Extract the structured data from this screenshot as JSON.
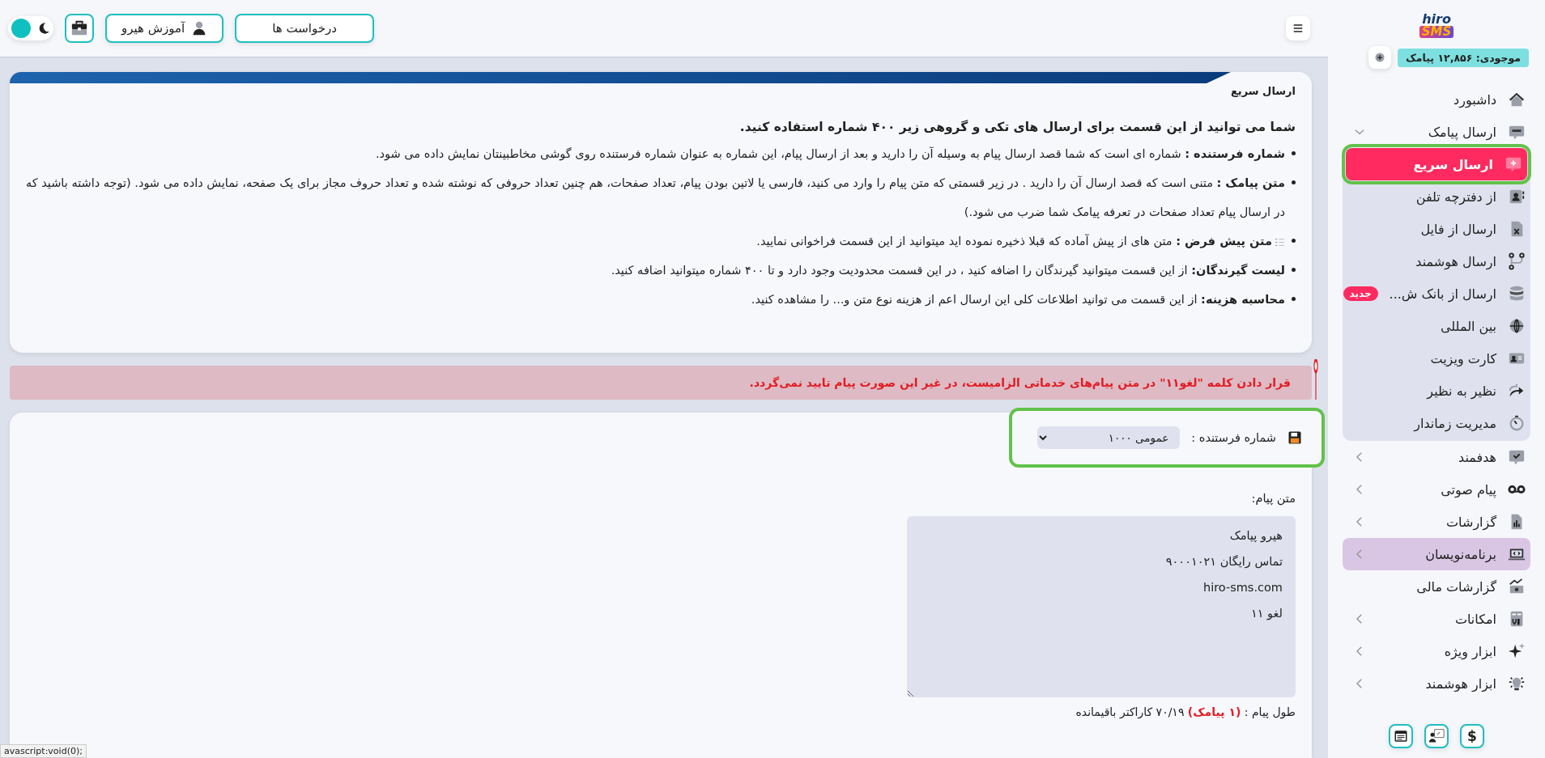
{
  "logo": {
    "line_1": "hiro",
    "line_2": "SMS"
  },
  "balance": {
    "label": "موجودی: ۱۲,۸۵۶ پیامک"
  },
  "sidebar": {
    "items": [
      {
        "kind": "link",
        "label": "داشبورد"
      },
      {
        "kind": "group",
        "label": "ارسال پیامک",
        "expanded": true,
        "hovered": false,
        "children": [
          {
            "label": "ارسال سریع",
            "selected": true,
            "highlighted": true
          },
          {
            "label": "از دفترچه تلفن",
            "selected": false,
            "highlighted": false
          },
          {
            "label": "ارسال از فایل",
            "selected": false,
            "highlighted": false
          },
          {
            "label": "ارسال هوشمند",
            "selected": false,
            "highlighted": false
          },
          {
            "label": "ارسال از بانک ش...",
            "selected": false,
            "highlighted": false,
            "badge": "جدید"
          },
          {
            "label": "بین المللی",
            "selected": false,
            "highlighted": false
          },
          {
            "label": "کارت ویزیت",
            "selected": false,
            "highlighted": false
          },
          {
            "label": "نظیر به نظیر",
            "selected": false,
            "highlighted": false
          },
          {
            "label": "مدیریت زماندار",
            "selected": false,
            "highlighted": false
          }
        ]
      },
      {
        "kind": "group",
        "label": "هدفمند",
        "expanded": false,
        "hovered": false
      },
      {
        "kind": "group",
        "label": "پیام صوتی",
        "expanded": false,
        "hovered": false
      },
      {
        "kind": "group",
        "label": "گزارشات",
        "expanded": false,
        "hovered": false
      },
      {
        "kind": "group",
        "label": "برنامه‌نویسان",
        "expanded": false,
        "hovered": true
      },
      {
        "kind": "link",
        "label": "گزارشات مالی"
      },
      {
        "kind": "group",
        "label": "امکانات",
        "expanded": false,
        "hovered": false
      },
      {
        "kind": "group",
        "label": "ابزار ویژه",
        "expanded": false,
        "hovered": false
      },
      {
        "kind": "group",
        "label": "ابزار هوشمند",
        "expanded": false,
        "hovered": false
      }
    ]
  },
  "sidebar_footer": {
    "symbol_button": "$"
  },
  "topbar": {
    "buttons": [
      {
        "label": "درخواست ها"
      },
      {
        "label": "آموزش هیرو"
      }
    ],
    "theme_toggle": {
      "dark_mode": false
    }
  },
  "intro_card": {
    "title": "ارسال سریع",
    "lead": "شما می توانید از این قسمت برای ارسال های تکی و گروهی زیر ۴۰۰ شماره استفاده کنید.",
    "bullets": [
      {
        "term": "شماره فرستنده :",
        "text": "شماره ای است که شما قصد ارسال پیام به وسیله آن را دارید و بعد از ارسال پیام، این شماره به عنوان شماره فرستنده روی گوشی مخاطبینتان نمایش داده می شود."
      },
      {
        "term": "متن پیامک :",
        "text": "متنی است که قصد ارسال آن را دارید . در زیر قسمتی که متن پیام را وارد می کنید، فارسی یا لاتین بودن پیام، تعداد صفحات، هم چنین تعداد حروفی که نوشته شده و تعداد حروف مجاز برای یک صفحه، نمایش داده می شود. (توجه داشته باشید که در ارسال پیام تعداد صفحات در تعرفه پیامک شما ضرب می شود.)"
      },
      {
        "term": "متن پیش فرض :",
        "text": "متن های از پیش آماده که قبلا ذخیره نموده اید میتوانید از این قسمت فراخوانی نمایید.",
        "with_icon": true
      },
      {
        "term": "لیست گیرندگان:",
        "text": "از این قسمت میتوانید گیرندگان را اضافه کنید ، در این قسمت محدودیت وجود دارد و تا ۴۰۰ شماره میتوانید اضافه کنید."
      },
      {
        "term": "محاسبه هزینه:",
        "text": "از این قسمت می توانید اطلاعات کلی این ارسال اعم از هزینه نوع متن و... را مشاهده کنید."
      }
    ]
  },
  "warning": "قرار دادن کلمه \"لغو۱۱\" در متن پیام‌های خدماتی الزامیست، در غیر این صورت پیام تایید نمی‌گردد.",
  "form": {
    "sender": {
      "label": "شماره فرستنده :",
      "value": "عمومی ۱۰۰۰",
      "highlighted": true
    },
    "message": {
      "label": "متن پیام:",
      "lines": [
        "هیرو پیامک",
        "تماس رایگان ۹۰۰۰۱۰۲۱",
        "hiro-sms.com",
        "لغو ۱۱"
      ]
    },
    "length": "طول پیام : **(۱ پیامک)** ۷۰/۱۹ کاراکتر باقیمانده"
  },
  "status_bar": "avascript:void(0);"
}
